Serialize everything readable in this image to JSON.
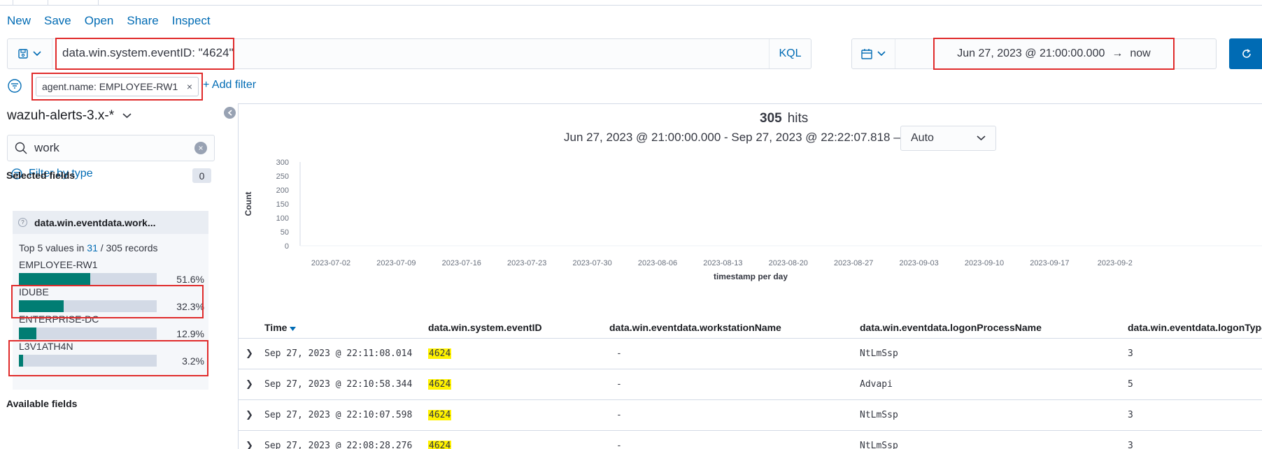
{
  "menu": {
    "new": "New",
    "save": "Save",
    "open": "Open",
    "share": "Share",
    "inspect": "Inspect"
  },
  "query": {
    "value": "data.win.system.eventID: \"4624\"",
    "language": "KQL",
    "saved_icon": "save-icon"
  },
  "time": {
    "start": "Jun 27, 2023 @ 21:00:00.000",
    "end": "now",
    "arrow": "→",
    "calendar_icon": "calendar-icon",
    "refresh_icon": "refresh-icon"
  },
  "filters": {
    "items": [
      {
        "label": "agent.name: EMPLOYEE-RW1",
        "remove": "×"
      }
    ],
    "add_label": "+ Add filter"
  },
  "sidebar": {
    "index_pattern": "wazuh-alerts-3.x-*",
    "search": {
      "value": "work"
    },
    "filter_by_type": "Filter by type",
    "filter_count": "0",
    "selected_fields_title": "Selected fields",
    "available_fields_title": "Available fields",
    "selected_field": {
      "name": "data.win.eventdata.work...",
      "type_token": "?"
    },
    "details": {
      "top_prefix": "Top 5 values in",
      "matched": "31",
      "total_sep": "/ 305 records",
      "values": [
        {
          "label": "EMPLOYEE-RW1",
          "percent": "51.6%",
          "fraction": 0.516
        },
        {
          "label": "IDUBE",
          "percent": "32.3%",
          "fraction": 0.323
        },
        {
          "label": "ENTERPRISE-DC",
          "percent": "12.9%",
          "fraction": 0.129
        },
        {
          "label": "L3V1ATH4N",
          "percent": "3.2%",
          "fraction": 0.032
        }
      ]
    }
  },
  "results": {
    "hits": "305",
    "hits_label": "hits",
    "range_text": "Jun 27, 2023 @ 21:00:00.000 - Sep 27, 2023 @ 22:22:07.818 —",
    "interval": "Auto"
  },
  "chart_data": {
    "type": "bar",
    "ylabel": "Count",
    "xlabel": "timestamp per day",
    "ylim": [
      0,
      300
    ],
    "yticks": [
      0,
      50,
      100,
      150,
      200,
      250,
      300
    ],
    "categories": [
      "2023-07-02",
      "2023-07-09",
      "2023-07-16",
      "2023-07-23",
      "2023-07-30",
      "2023-08-06",
      "2023-08-13",
      "2023-08-20",
      "2023-08-27",
      "2023-09-03",
      "2023-09-10",
      "2023-09-17",
      "2023-09-2"
    ],
    "values": [],
    "grid": false
  },
  "table": {
    "columns": [
      "Time",
      "data.win.system.eventID",
      "data.win.eventdata.workstationName",
      "data.win.eventdata.logonProcessName",
      "data.win.eventdata.logonType"
    ],
    "sort_icon": "sort-down-icon",
    "rows": [
      {
        "time": "Sep 27, 2023 @ 22:11:08.014",
        "event_id": "4624",
        "workstation": "-",
        "process": "NtLmSsp",
        "logon_type": "3"
      },
      {
        "time": "Sep 27, 2023 @ 22:10:58.344",
        "event_id": "4624",
        "workstation": "-",
        "process": "Advapi",
        "logon_type": "5"
      },
      {
        "time": "Sep 27, 2023 @ 22:10:07.598",
        "event_id": "4624",
        "workstation": "-",
        "process": "NtLmSsp",
        "logon_type": "3"
      },
      {
        "time": "Sep 27, 2023 @ 22:08:28.276",
        "event_id": "4624",
        "workstation": "-",
        "process": "NtLmSsp",
        "logon_type": "3"
      }
    ]
  },
  "colors": {
    "accent": "#006bb4",
    "bar_fill": "#017d73",
    "highlight": "#fff200",
    "annotation": "#e02b2b"
  }
}
